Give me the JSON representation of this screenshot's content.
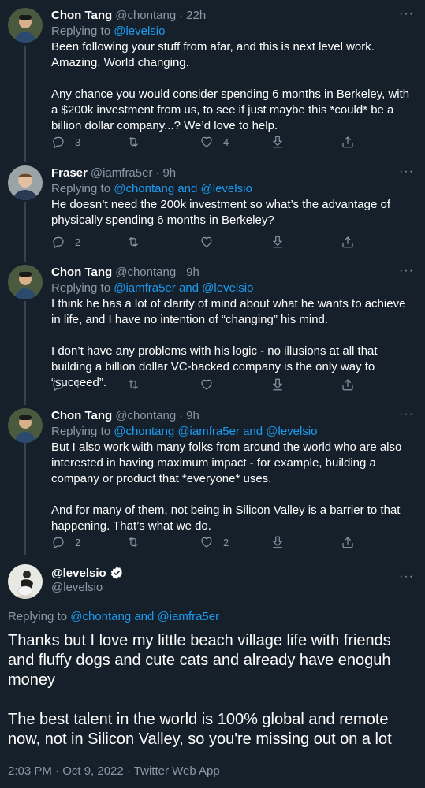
{
  "tweets": [
    {
      "name": "Chon Tang",
      "handle": "@chontang",
      "time": "22h",
      "reply_prefix": "Replying to ",
      "reply_mentions": "@levelsio",
      "paragraphs": [
        "Been following your stuff from afar, and this is next level work. Amazing. World changing.",
        "Any chance you would consider spending 6 months in Berkeley, with a $200k investment from us, to see if just maybe this *could* be a billion dollar company...? We’d love to help."
      ],
      "replies": "3",
      "likes": "4"
    },
    {
      "name": "Fraser",
      "handle": "@iamfra5er",
      "time": "9h",
      "reply_prefix": "Replying to ",
      "reply_mentions": "@chontang and @levelsio",
      "paragraphs": [
        "He doesn’t need the 200k investment so what’s the advantage of physically spending 6 months in Berkeley?"
      ],
      "replies": "2",
      "likes": ""
    },
    {
      "name": "Chon Tang",
      "handle": "@chontang",
      "time": "9h",
      "reply_prefix": "Replying to ",
      "reply_mentions": "@iamfra5er and @levelsio",
      "paragraphs": [
        "I think he has a lot of clarity of mind about what he wants to achieve in life, and I have no intention of “changing” his mind.",
        "I don’t have any problems with his logic - no illusions at all that building a billion dollar VC-backed company is the only way to “succeed”."
      ],
      "replies": "1",
      "likes": ""
    },
    {
      "name": "Chon Tang",
      "handle": "@chontang",
      "time": "9h",
      "reply_prefix": "Replying to ",
      "reply_mentions": "@chontang @iamfra5er and @levelsio",
      "paragraphs": [
        "But I also work with many folks from around the world who are also interested in having maximum impact - for example, building a company or product that *everyone* uses.",
        "And for many of them, not being in Silicon Valley is a barrier to that happening. That’s what we do."
      ],
      "replies": "2",
      "likes": "2"
    }
  ],
  "focal": {
    "name": "@levelsio",
    "handle": "@levelsio",
    "reply_prefix": "Replying to ",
    "reply_mentions": "@chontang and @iamfra5er",
    "paragraph1": "Thanks but I love my little beach village life with friends and fluffy dogs and cute cats and already have enoguh money",
    "paragraph2": "The best talent in the world is 100% global and remote now, not in Silicon Valley, so you're missing out on a lot",
    "meta": "2:03 PM · Oct 9, 2022 · Twitter Web App"
  },
  "ui": {
    "dot_separator": "·",
    "more_glyph": "···"
  },
  "colors": {
    "background": "#15202b",
    "accent": "#1d9bf0",
    "muted": "#8b98a5",
    "thread_line": "#38444d"
  },
  "icons": [
    "reply-icon",
    "retweet-icon",
    "like-icon",
    "download-icon",
    "share-icon",
    "more-icon",
    "verified-icon"
  ]
}
